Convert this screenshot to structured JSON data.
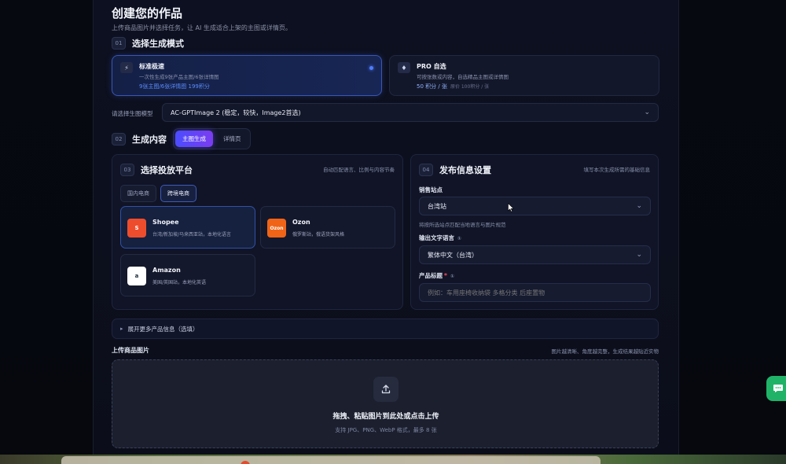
{
  "page": {
    "title": "创建您的作品",
    "subtitle": "上传商品图片并选择任务，让 AI 生成适合上架的主图或详情页。"
  },
  "step1": {
    "num": "01",
    "title": "选择生成模式",
    "modes": [
      {
        "icon": "lightning-icon",
        "glyph": "⚡",
        "name": "标准极速",
        "desc": "一次性生成9张产品主图/6张详情图",
        "price": "9张主图/6张详情图 199积分",
        "price_note": "",
        "selected": true
      },
      {
        "icon": "gem-icon",
        "glyph": "♦",
        "name": "PRO 自选",
        "desc": "可按张数或内容，自选精品主图或详情图",
        "price": "50 积分 / 张",
        "price_note": "原价 100积分 / 张",
        "selected": false
      }
    ]
  },
  "model": {
    "label": "请选择生图模型",
    "value": "AC-GPTImage 2 (稳定，较快，Image2首选)"
  },
  "step2": {
    "num": "02",
    "title": "生成内容",
    "tabs": [
      "主图生成",
      "详情页"
    ],
    "active_tab": 0
  },
  "step3": {
    "num": "03",
    "title": "选择投放平台",
    "hint": "自动匹配语言、比例与内容节奏",
    "region_tabs": [
      "国内电商",
      "跨境电商"
    ],
    "active_region": 1,
    "platforms": [
      {
        "name": "Shopee",
        "desc": "台湾/新加坡/马来西亚站，本地化语言",
        "logo": "S",
        "color": "#ee4d2d",
        "selected": true
      },
      {
        "name": "Ozon",
        "desc": "俄罗斯站，俄语货架风格",
        "logo": "Ozon",
        "color": "#f06418",
        "selected": false
      },
      {
        "name": "Amazon",
        "desc": "美国/英国站，本地化英语",
        "logo": "a",
        "color": "#ffffff",
        "selected": false
      }
    ]
  },
  "step4": {
    "num": "04",
    "title": "发布信息设置",
    "hint": "填写本次生成所需的基础信息",
    "site_label": "销售站点",
    "site_value": "台湾站",
    "site_hint": "将按所选站点匹配当地语言与图片规范",
    "lang_label": "输出文字语言",
    "lang_value": "繁体中文（台湾）",
    "product_label": "产品标题",
    "required_mark": "*",
    "info_glyph": "①",
    "product_placeholder": "例如：车用座椅收纳袋 多格分类 后座置物"
  },
  "expander": {
    "glyph": "▸",
    "label": "展开更多产品信息（选填）"
  },
  "upload": {
    "label": "上传商品图片",
    "hint": "图片越清晰、角度越完整，生成结果越贴近实物",
    "main_text": "拖拽、粘贴图片到此处或点击上传",
    "sub_text": "支持 JPG、PNG、WebP 格式，最多 8 张"
  },
  "colors": {
    "accent": "#4e7dff",
    "tab_gradient_start": "#4b4cff",
    "tab_gradient_end": "#7b3cf0",
    "chat": "#20b368"
  }
}
